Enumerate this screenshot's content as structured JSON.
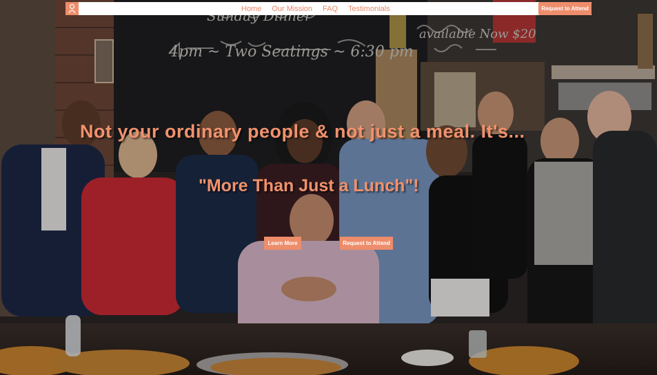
{
  "nav": {
    "links": [
      "Home",
      "Our Mission",
      "FAQ",
      "Testimonials"
    ],
    "cta": "Request to Attend"
  },
  "hero": {
    "headline": "Not your ordinary people & not just a meal. It's...",
    "subheadline": "\"More Than Just a Lunch\"!",
    "buttons": {
      "learn_more": "Learn More",
      "request": "Request to Attend"
    },
    "background": {
      "board_text": [
        "Sunday Dinner",
        "4pm ~ Two Seatings ~ 6:30 pm",
        "available Now $20"
      ]
    }
  },
  "colors": {
    "accent": "#ee8d6b",
    "nav_bg": "#ffffff"
  }
}
